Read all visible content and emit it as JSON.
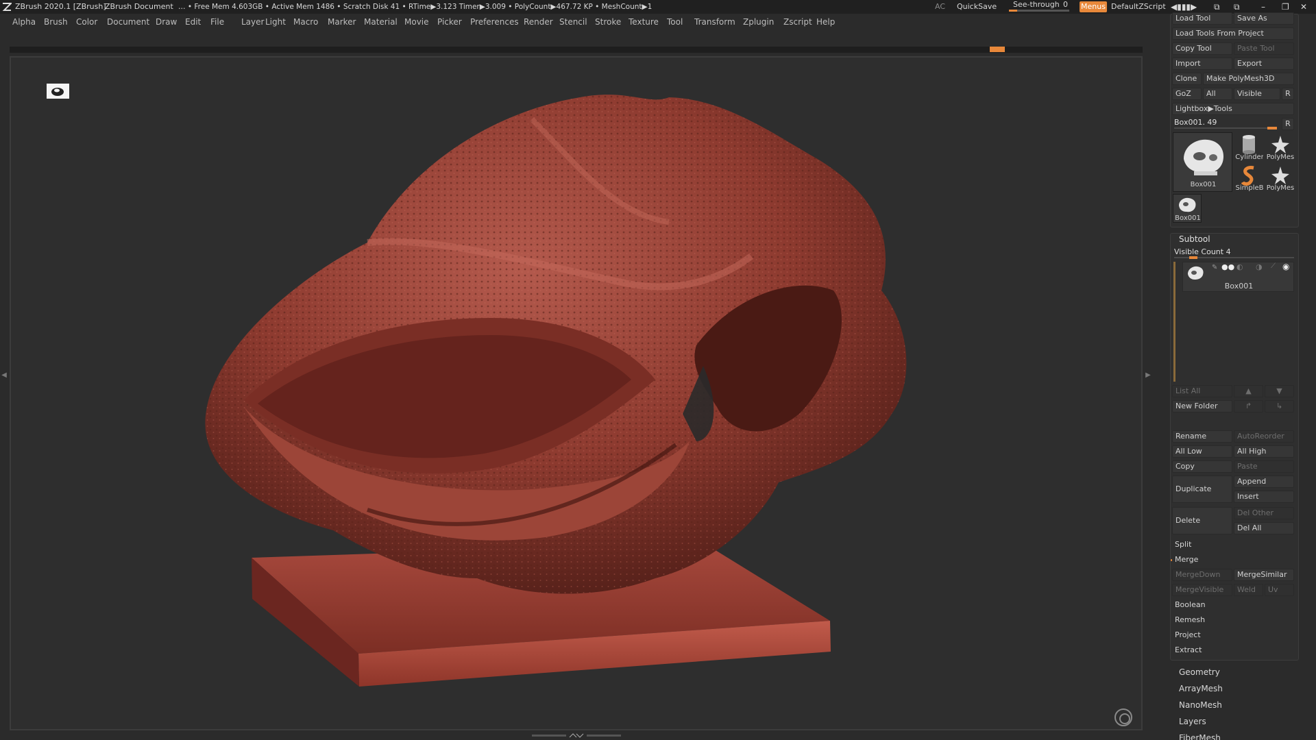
{
  "titlebar": {
    "app": "ZBrush 2020.1 [ZBrush]",
    "document": "ZBrush Document",
    "stats": "… • Free Mem 4.603GB • Active Mem 1486 • Scratch Disk 41 •  RTime▶3.123 Timer▶3.009 • PolyCount▶467.72 KP  • MeshCount▶1",
    "ac": "AC",
    "quicksave": "QuickSave",
    "seethrough_label": "See-through",
    "seethrough_value": "0",
    "seethrough_level": 0,
    "menus": "Menus",
    "script": "DefaultZScript",
    "accent": "#e8883a"
  },
  "menubar": [
    "Alpha",
    "Brush",
    "Color",
    "Document",
    "Draw",
    "Edit",
    "File",
    "Layer",
    "Light",
    "Macro",
    "Marker",
    "Material",
    "Movie",
    "Picker",
    "Preferences",
    "Render",
    "Stencil",
    "Stroke",
    "Texture",
    "Tool",
    "Transform",
    "Zplugin",
    "Zscript",
    "Help"
  ],
  "tool_panel": {
    "load_tool": "Load Tool",
    "save_as": "Save As",
    "load_from_project": "Load Tools From Project",
    "copy_tool": "Copy Tool",
    "paste_tool": "Paste Tool",
    "import": "Import",
    "export": "Export",
    "clone": "Clone",
    "make_polymesh": "Make PolyMesh3D",
    "goz": "GoZ",
    "all": "All",
    "visible": "Visible",
    "r": "R",
    "lightbox_tools": "Lightbox▶Tools",
    "current_tool": "Box001. 49",
    "current_tool_level": 0.9,
    "thumbs": [
      {
        "label": "Box001",
        "icon": "skull-mesh-icon"
      },
      {
        "label": "Cylinder",
        "icon": "cylinder-icon"
      },
      {
        "label": "PolyMes",
        "icon": "polymesh-star-icon"
      },
      {
        "label": "SimpleB",
        "icon": "simplebrush-icon"
      },
      {
        "label": "PolyMes",
        "icon": "polymesh-star-icon"
      },
      {
        "label": "Box001",
        "icon": "skull-mesh-icon"
      }
    ]
  },
  "subtool": {
    "title": "Subtool",
    "visible_count": "Visible Count 4",
    "visible_count_level": 0.1,
    "item_label": "Box001",
    "list_all": "List All",
    "new_folder": "New Folder",
    "rename": "Rename",
    "autoreorder": "AutoReorder",
    "all_low": "All Low",
    "all_high": "All High",
    "copy": "Copy",
    "paste": "Paste",
    "duplicate": "Duplicate",
    "append": "Append",
    "insert": "Insert",
    "delete": "Delete",
    "del_other": "Del Other",
    "del_all": "Del All",
    "split": "Split",
    "merge": "Merge",
    "mergedown": "MergeDown",
    "mergesimilar": "MergeSimilar",
    "mergevisible": "MergeVisible",
    "weld": "Weld",
    "uv": "Uv",
    "boolean": "Boolean",
    "remesh": "Remesh",
    "project": "Project",
    "extract": "Extract"
  },
  "lower_sections": [
    "Geometry",
    "ArrayMesh",
    "NanoMesh",
    "Layers",
    "FiberMesh"
  ],
  "colors": {
    "sculpt": "#8a3a2e",
    "sculpt_light": "#b0554a",
    "sculpt_dark": "#4a1c16"
  }
}
